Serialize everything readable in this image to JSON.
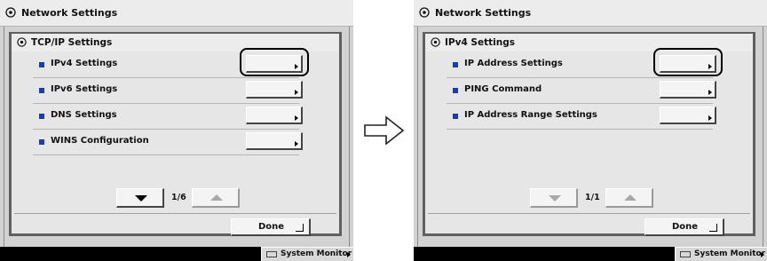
{
  "left_screen": {
    "window_title": "Network Settings",
    "panel_title": "TCP/IP Settings",
    "items": [
      {
        "label": "IPv4 Settings"
      },
      {
        "label": "IPv6 Settings"
      },
      {
        "label": "DNS Settings"
      },
      {
        "label": "WINS Configuration"
      }
    ],
    "page_indicator": "1/6",
    "done_label": "Done",
    "status_button": "System Monitor"
  },
  "right_screen": {
    "window_title": "Network Settings",
    "panel_title": "IPv4 Settings",
    "items": [
      {
        "label": "IP Address Settings"
      },
      {
        "label": "PING Command"
      },
      {
        "label": "IP Address Range Settings"
      }
    ],
    "page_indicator": "1/1",
    "done_label": "Done",
    "status_button": "System Monitor"
  },
  "icons": {
    "settings": "gear-icon",
    "next": "arrow-right-icon",
    "page_down": "triangle-down-icon",
    "page_up": "triangle-up-icon",
    "enter": "enter-icon"
  },
  "colors": {
    "bullet": "#1c3ea0",
    "panel_frame": "#606060"
  }
}
